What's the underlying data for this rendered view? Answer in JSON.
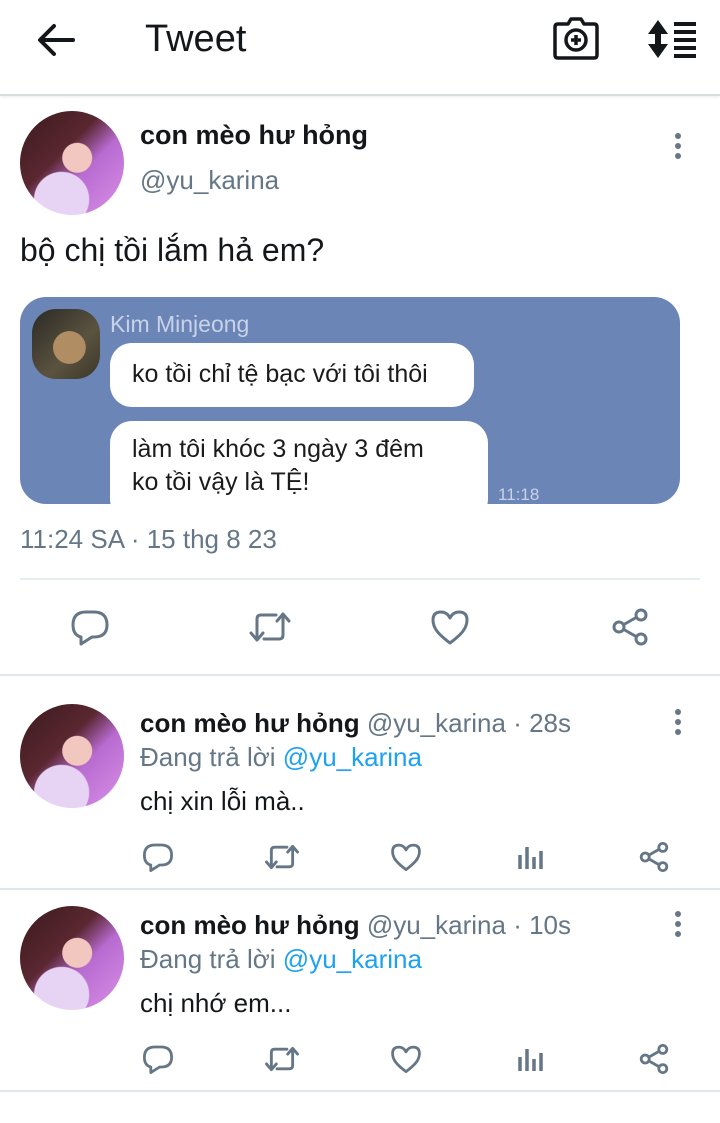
{
  "header": {
    "title": "Tweet",
    "back_icon": "arrow-left-icon",
    "camera_icon": "camera-add-icon",
    "sort_icon": "sort-list-icon"
  },
  "main_tweet": {
    "name": "con mèo hư hỏng",
    "handle": "@yu_karina",
    "text": "bộ chị tồi lắm hả em?",
    "timestamp": "11:24 SA · 15 thg 8 23",
    "media": {
      "background": "#6b85b6",
      "sender": "Kim Minjeong",
      "bubble_1": "ko tồi chỉ tệ bạc với tôi thôi",
      "bubble_2_line1": "làm tôi khóc 3 ngày 3 đêm",
      "bubble_2_line2": "ko tồi vậy là TỆ!",
      "time": "11:18"
    },
    "actions": [
      "reply-icon",
      "retweet-icon",
      "like-icon",
      "share-icon"
    ]
  },
  "replies": [
    {
      "name": "con mèo hư hỏng",
      "handle": "@yu_karina",
      "age": "· 28s",
      "replying_prefix": "Đang trả lời",
      "replying_to": "@yu_karina",
      "text": "chị xin lỗi mà.."
    },
    {
      "name": "con mèo hư hỏng",
      "handle": "@yu_karina",
      "age": "· 10s",
      "replying_prefix": "Đang trả lời",
      "replying_to": "@yu_karina",
      "text": "chị nhớ em..."
    }
  ],
  "colors": {
    "text": "#14171a",
    "secondary": "#657786",
    "accent": "#1da1f2",
    "divider": "#e6ecf0"
  }
}
